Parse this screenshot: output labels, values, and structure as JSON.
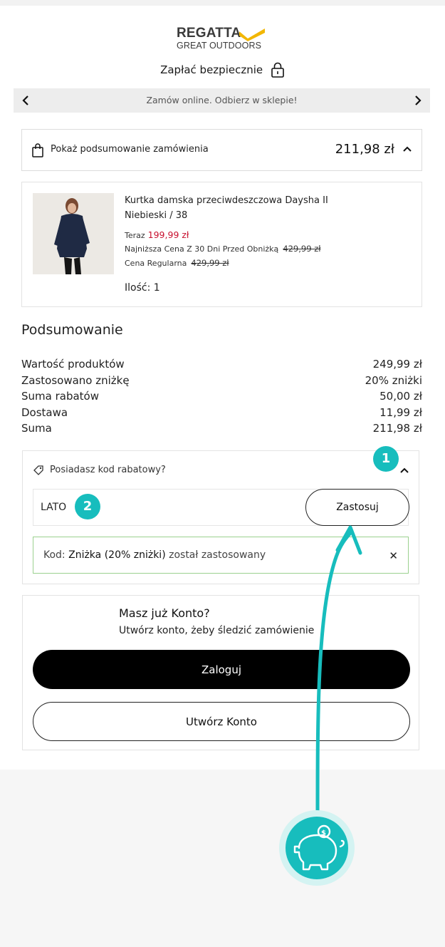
{
  "brand": {
    "logo_top": "REGATTA",
    "logo_bottom": "GREAT OUTDOORS",
    "accent": "#f2b705"
  },
  "header": {
    "secure_label": "Zapłać bezpiecznie"
  },
  "banner": {
    "text": "Zamów online. Odbierz w sklepie!"
  },
  "order_toggle": {
    "label": "Pokaż podsumowanie zamówienia",
    "total": "211,98 zł"
  },
  "product": {
    "name": "Kurtka damska przeciwdeszczowa Daysha II",
    "variant": "Niebieski / 38",
    "now_label": "Teraz",
    "now_price": "199,99 zł",
    "lowest_label": "Najniższa Cena Z 30 Dni Przed Obniżką",
    "lowest_price": "429,99 zł",
    "regular_label": "Cena Regularna",
    "regular_price": "429,99 zł",
    "quantity": "Ilość: 1"
  },
  "summary": {
    "title": "Podsumowanie",
    "rows": [
      {
        "label": "Wartość produktów",
        "value": "249,99 zł"
      },
      {
        "label": "Zastosowano zniżkę",
        "value": "20% zniżki"
      },
      {
        "label": "Suma rabatów",
        "value": "50,00 zł"
      },
      {
        "label": "Dostawa",
        "value": "11,99 zł"
      },
      {
        "label": "Suma",
        "value": "211,98 zł"
      }
    ]
  },
  "discount": {
    "label": "Posiadasz kod rabatowy?",
    "code_value": "LATO",
    "apply_label": "Zastosuj",
    "applied_prefix": "Kod:",
    "applied_code": "Zniżka (20% zniżki)",
    "applied_suffix": "został zastosowany",
    "close_glyph": "✕"
  },
  "account": {
    "heading": "Masz już Konto?",
    "subheading": "Utwórz konto, żeby śledzić zamówienie",
    "login_label": "Zaloguj",
    "create_label": "Utwórz Konto"
  },
  "annotations": {
    "badge1": "1",
    "badge2": "2",
    "color": "#17bdbd"
  }
}
